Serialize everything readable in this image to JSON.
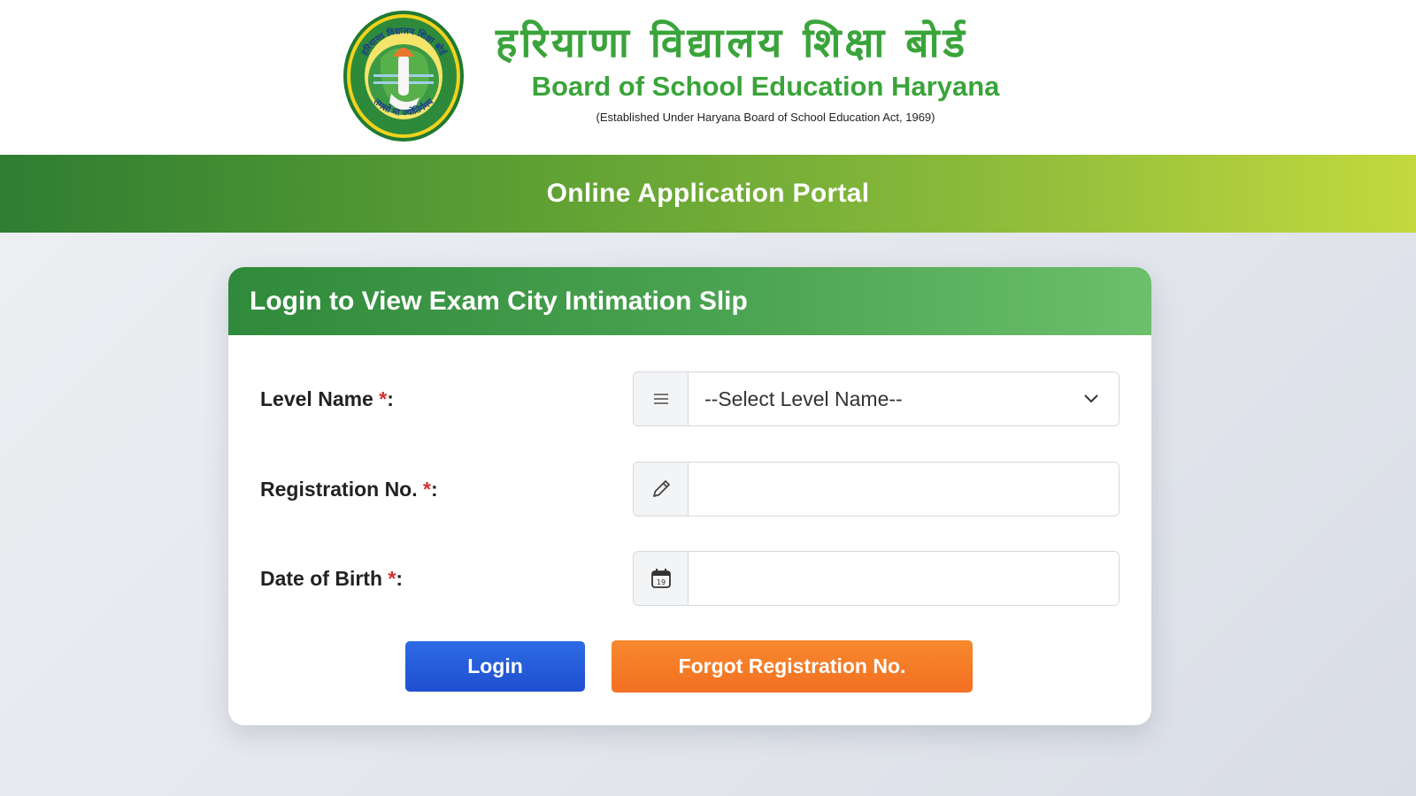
{
  "header": {
    "hindi_title": "हरियाणा विद्यालय शिक्षा बोर्ड",
    "english_title": "Board of School Education Haryana",
    "established": "(Established Under Haryana Board of School Education Act, 1969)",
    "logo_text_top": "हरियाणा विद्यालय शिक्षा बोर्ड",
    "logo_text_bottom": "तमसो मा ज्योतिर्गमय"
  },
  "banner": {
    "title": "Online Application Portal"
  },
  "login_card": {
    "title": "Login to View Exam City Intimation Slip",
    "fields": [
      {
        "label": "Level Name ",
        "required_mark": "*",
        "suffix": ":",
        "icon": "list-icon",
        "type": "select",
        "value": "--Select Level Name--"
      },
      {
        "label": "Registration No. ",
        "required_mark": "*",
        "suffix": ":",
        "icon": "pencil-icon",
        "type": "text",
        "value": ""
      },
      {
        "label": "Date of Birth ",
        "required_mark": "*",
        "suffix": ":",
        "icon": "calendar-icon",
        "type": "text",
        "value": ""
      }
    ],
    "calendar_icon_day": "19",
    "login_button": "Login",
    "forgot_button": "Forgot Registration No."
  },
  "colors": {
    "green_text": "#3aa43a",
    "banner_start": "#2e7d32",
    "banner_end": "#c3d93e",
    "login_blue": "#1f4fd0",
    "forgot_orange": "#f37021",
    "required_red": "#d32f2f"
  }
}
